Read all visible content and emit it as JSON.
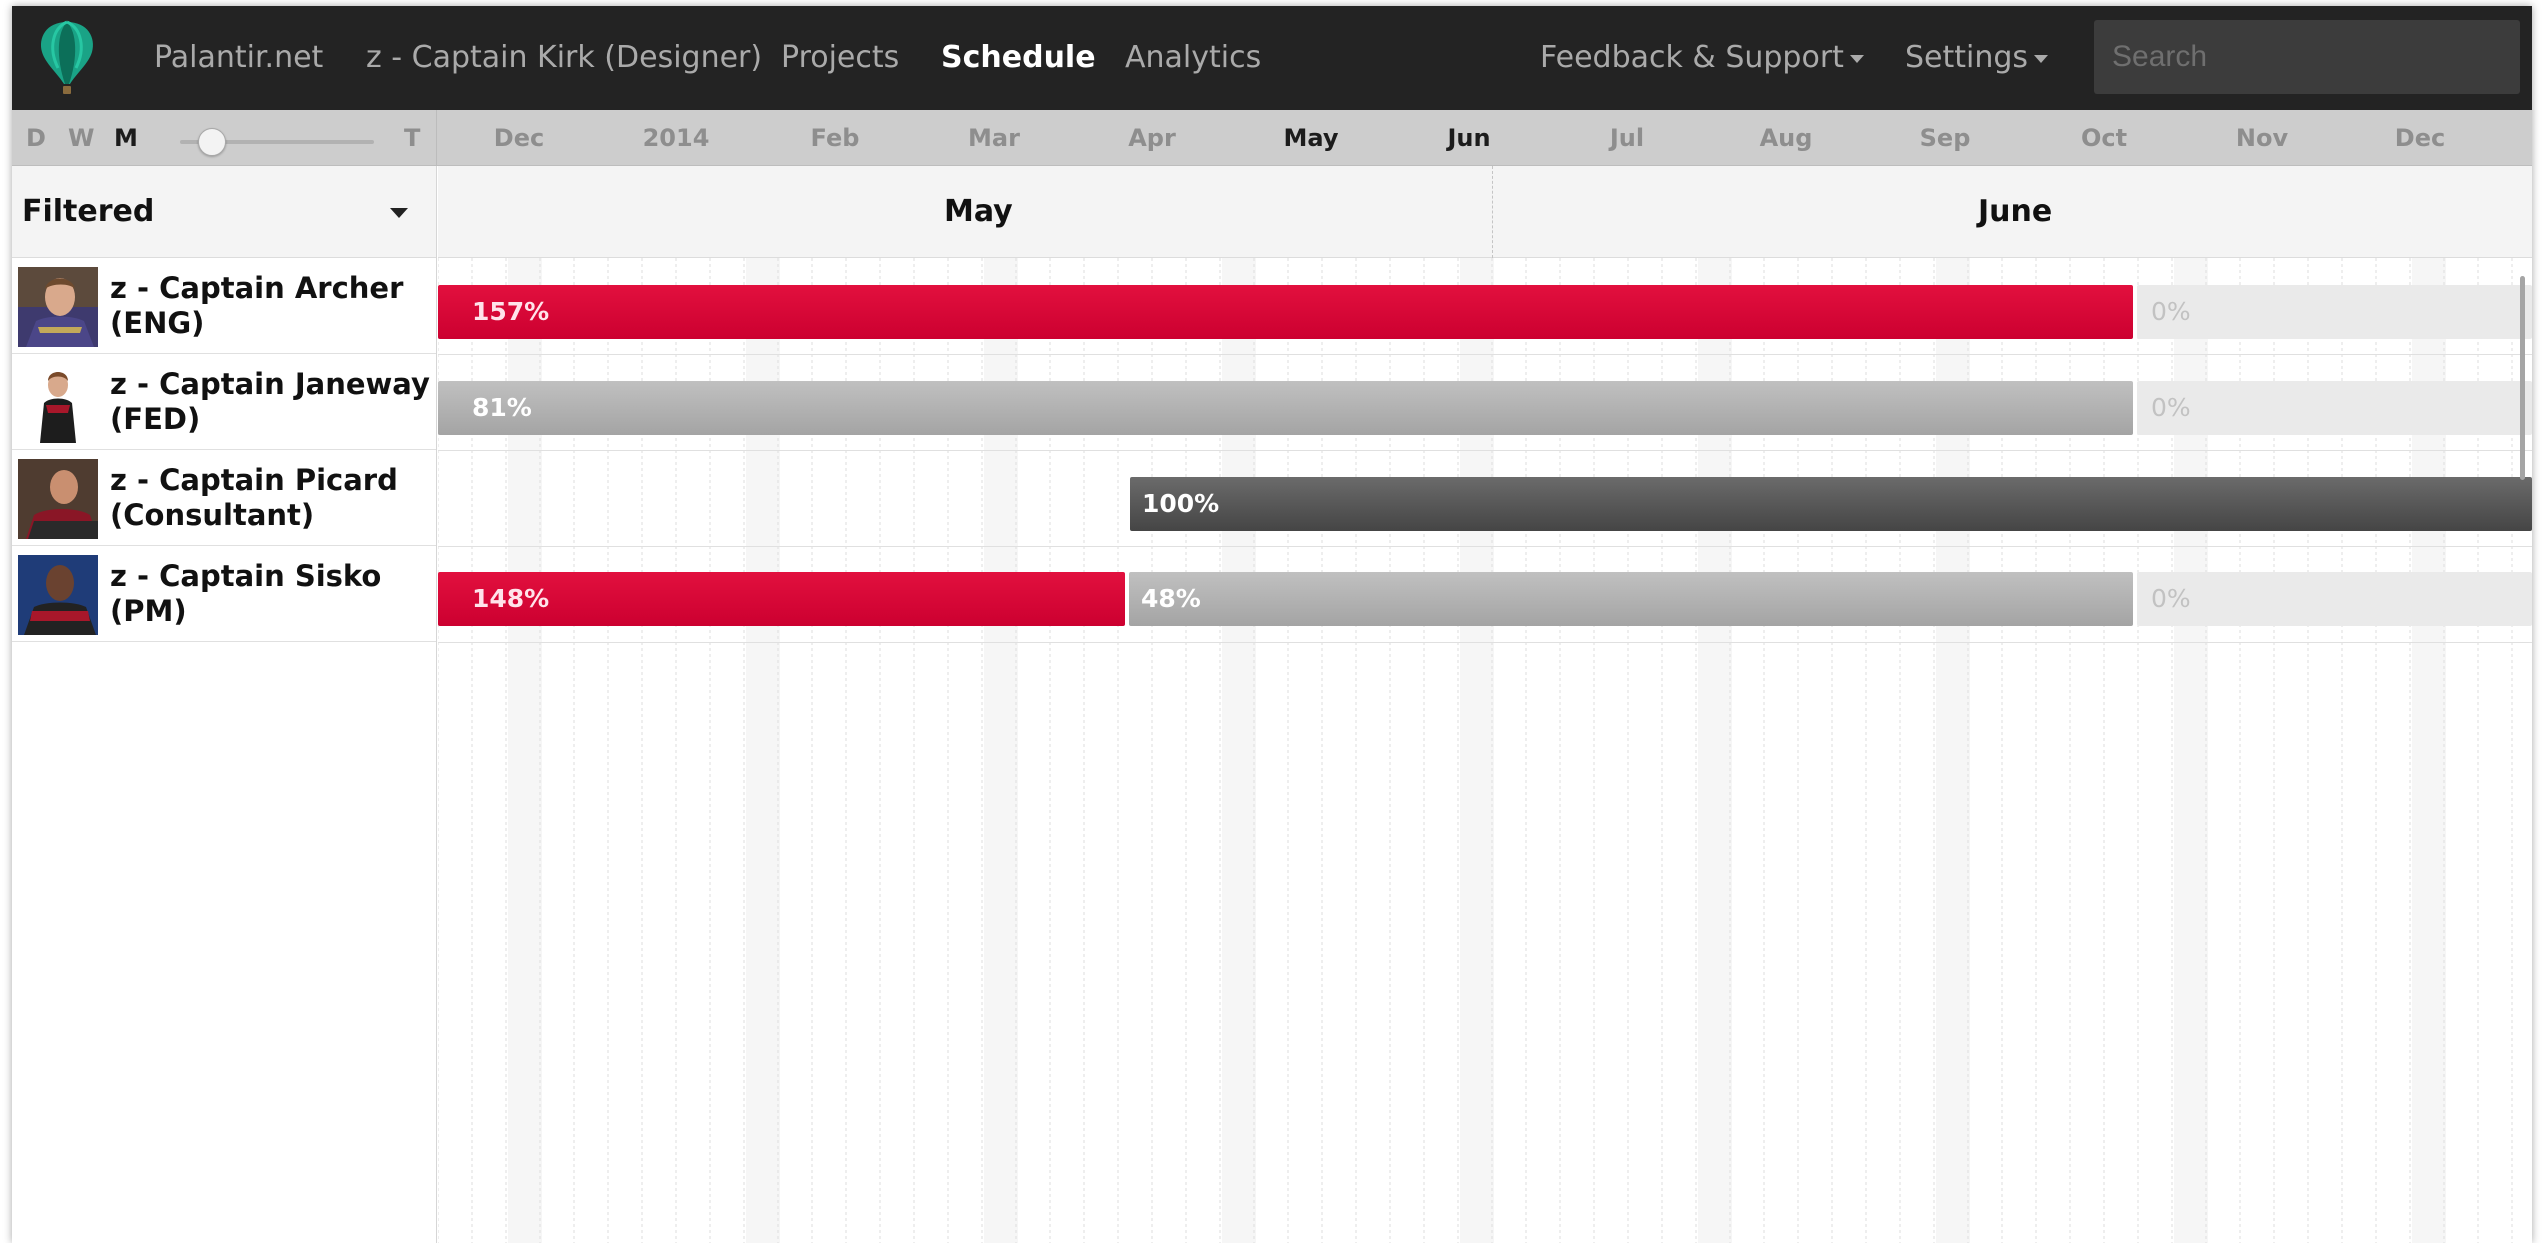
{
  "nav": {
    "links": [
      {
        "label": "Palantir.net"
      },
      {
        "label": "z - Captain Kirk (Designer)"
      },
      {
        "label": "Projects"
      },
      {
        "label": "Schedule",
        "active": true
      },
      {
        "label": "Analytics"
      }
    ],
    "feedback_label": "Feedback & Support",
    "settings_label": "Settings",
    "search_placeholder": "Search"
  },
  "zoom": {
    "letters": [
      "D",
      "W",
      "M",
      "T"
    ],
    "active_letter": "M"
  },
  "timeline": {
    "labels": [
      "Dec",
      "2014",
      "Feb",
      "Mar",
      "Apr",
      "May",
      "Jun",
      "Jul",
      "Aug",
      "Sep",
      "Oct",
      "Nov",
      "Dec"
    ],
    "active": [
      "May",
      "Jun"
    ]
  },
  "filter": {
    "label": "Filtered"
  },
  "months": [
    "May",
    "June"
  ],
  "people": [
    {
      "name": "z - Captain Archer (ENG)",
      "bars": [
        {
          "label": "157%",
          "style": "red"
        },
        {
          "label": "0%",
          "style": "faint"
        }
      ]
    },
    {
      "name": "z - Captain Janeway (FED)",
      "bars": [
        {
          "label": "81%",
          "style": "gray"
        },
        {
          "label": "0%",
          "style": "faint"
        }
      ]
    },
    {
      "name": "z - Captain Picard (Consultant)",
      "bars": [
        {
          "label": "100%",
          "style": "dark"
        }
      ]
    },
    {
      "name": "z - Captain Sisko (PM)",
      "bars": [
        {
          "label": "148%",
          "style": "red"
        },
        {
          "label": "48%",
          "style": "gray"
        },
        {
          "label": "0%",
          "style": "faint"
        }
      ]
    }
  ],
  "colors": {
    "nav_bg": "#232323",
    "over_allocated": "#d90036",
    "allocated": "#b0b0b0",
    "full": "#555555",
    "unallocated": "#eaeaea"
  },
  "icons": [
    "balloon-logo-icon",
    "caret-down-icon"
  ]
}
